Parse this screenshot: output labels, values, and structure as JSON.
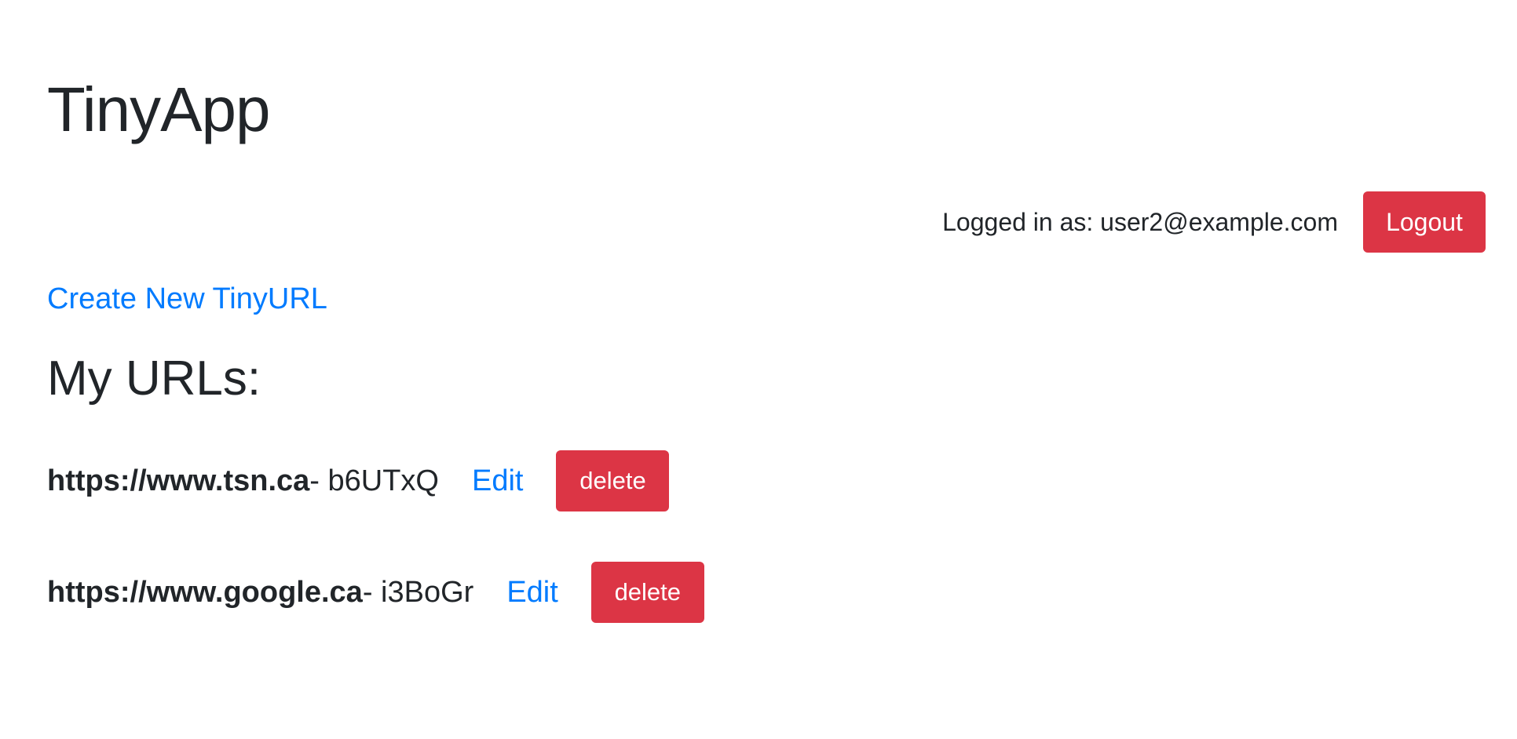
{
  "header": {
    "app_title": "TinyApp"
  },
  "session": {
    "logged_in_text": "Logged in as: user2@example.com",
    "logout_label": "Logout"
  },
  "actions": {
    "create_label": "Create New TinyURL"
  },
  "urls": {
    "title": "My URLs:",
    "items": [
      {
        "long_url": "https://www.tsn.ca",
        "short_text": "- b6UTxQ",
        "edit_label": "Edit",
        "delete_label": "delete"
      },
      {
        "long_url": "https://www.google.ca",
        "short_text": "- i3BoGr",
        "edit_label": "Edit",
        "delete_label": "delete"
      }
    ]
  },
  "colors": {
    "link": "#007bff",
    "danger": "#dc3545",
    "text": "#212529"
  }
}
